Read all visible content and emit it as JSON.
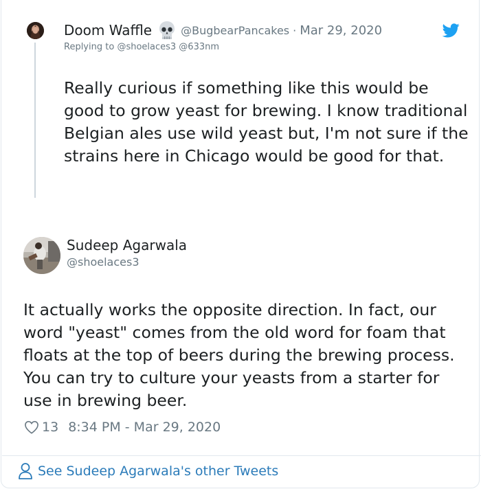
{
  "parent_tweet": {
    "author_name": "Doom Waffle",
    "name_emoji": "skull-emoji",
    "handle": "@BugbearPancakes",
    "separator": "·",
    "date": "Mar 29, 2020",
    "replying_prefix": "Replying to",
    "replying_to": "@shoelaces3 @633nm",
    "text": "Really curious if something like this would be good to grow yeast for brewing. I know traditional Belgian ales use wild yeast but, I'm not sure if the strains here in Chicago would be good for that."
  },
  "main_tweet": {
    "author_name": "Sudeep Agarwala",
    "handle": "@shoelaces3",
    "text": "It actually works the opposite direction. In fact, our word \"yeast\" comes from the old word for foam that floats at the top of beers during the brewing process. You can try to culture your yeasts from a starter for use in brewing beer.",
    "like_count": "13",
    "timestamp": "8:34 PM - Mar 29, 2020"
  },
  "footer": {
    "link_text": "See Sudeep Agarwala's other Tweets"
  },
  "colors": {
    "text": "#1c2022",
    "secondary": "#697882",
    "link": "#2b7bb9",
    "twitter_blue": "#1da1f2",
    "border": "#e1e8ed"
  },
  "icons": [
    "twitter-bird-icon",
    "heart-icon",
    "person-icon",
    "skull-emoji"
  ]
}
